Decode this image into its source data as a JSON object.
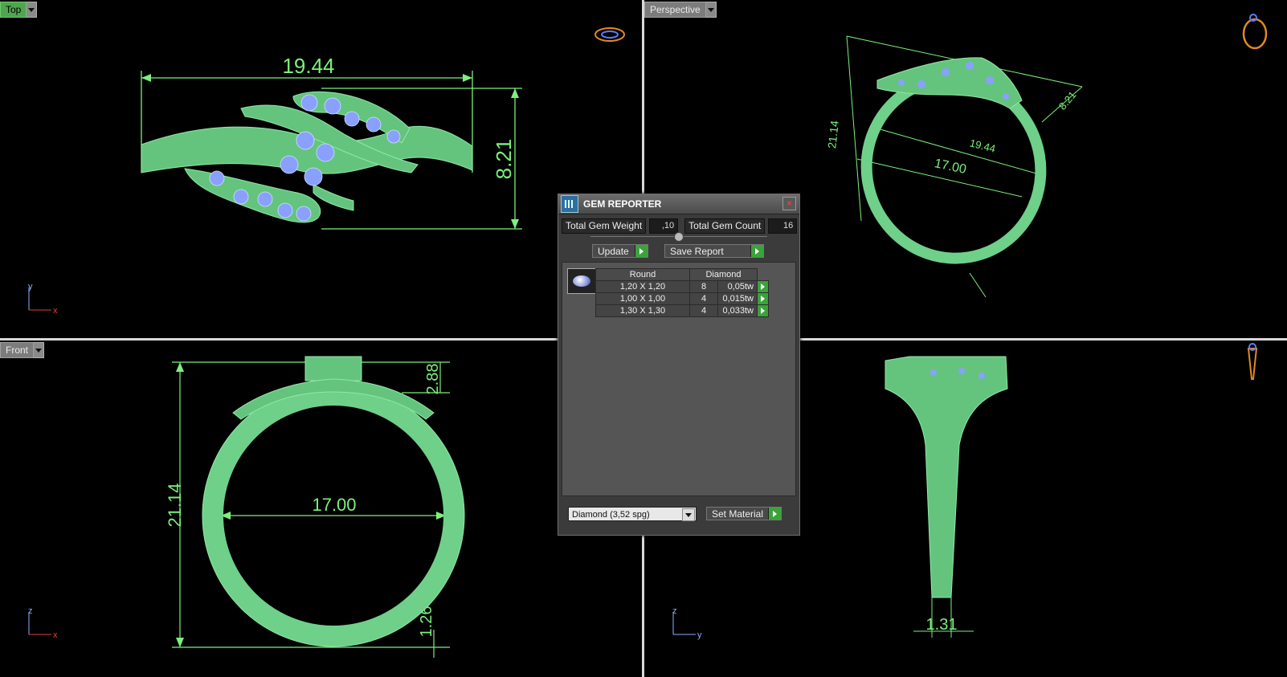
{
  "viewports": {
    "top": {
      "label": "Top",
      "active": true
    },
    "perspective": {
      "label": "Perspective",
      "active": false
    },
    "front": {
      "label": "Front",
      "active": false
    },
    "right": {
      "label": "",
      "active": false
    }
  },
  "dimensions": {
    "top_width": "19.44",
    "top_height": "8.21",
    "persp_height": "21.14",
    "persp_width": "19.44",
    "persp_inner": "17.00",
    "persp_side": "8.21",
    "front_height": "21.14",
    "front_inner": "17.00",
    "front_top": "2.88",
    "front_band": "1.26",
    "side_band": "1.31"
  },
  "axes": {
    "top": {
      "v": "y",
      "h": "x"
    },
    "front": {
      "v": "z",
      "h": "x"
    },
    "right": {
      "v": "z",
      "h": "y"
    }
  },
  "gem_reporter": {
    "title": "GEM REPORTER",
    "total_weight_label": "Total Gem Weight",
    "total_weight": ",10",
    "total_count_label": "Total Gem Count",
    "total_count": "16",
    "update_label": "Update",
    "save_label": "Save Report",
    "table_header": {
      "shape": "Round",
      "material": "Diamond"
    },
    "rows": [
      {
        "size": "1,20 X 1,20",
        "count": "8",
        "weight": "0,05tw"
      },
      {
        "size": "1,00 X 1,00",
        "count": "4",
        "weight": "0,015tw"
      },
      {
        "size": "1,30 X 1,30",
        "count": "4",
        "weight": "0,033tw"
      }
    ],
    "material_select": "Diamond    (3,52 spg)",
    "set_material_label": "Set Material"
  },
  "colors": {
    "model": "#6fd08a",
    "dimension": "#7cf07c",
    "gem": "#8aa0ff",
    "background": "#000000"
  },
  "icons": [
    "ring-top-icon",
    "ring-perspective-icon",
    "ring-side-icon",
    "gem-icon",
    "close-icon"
  ]
}
